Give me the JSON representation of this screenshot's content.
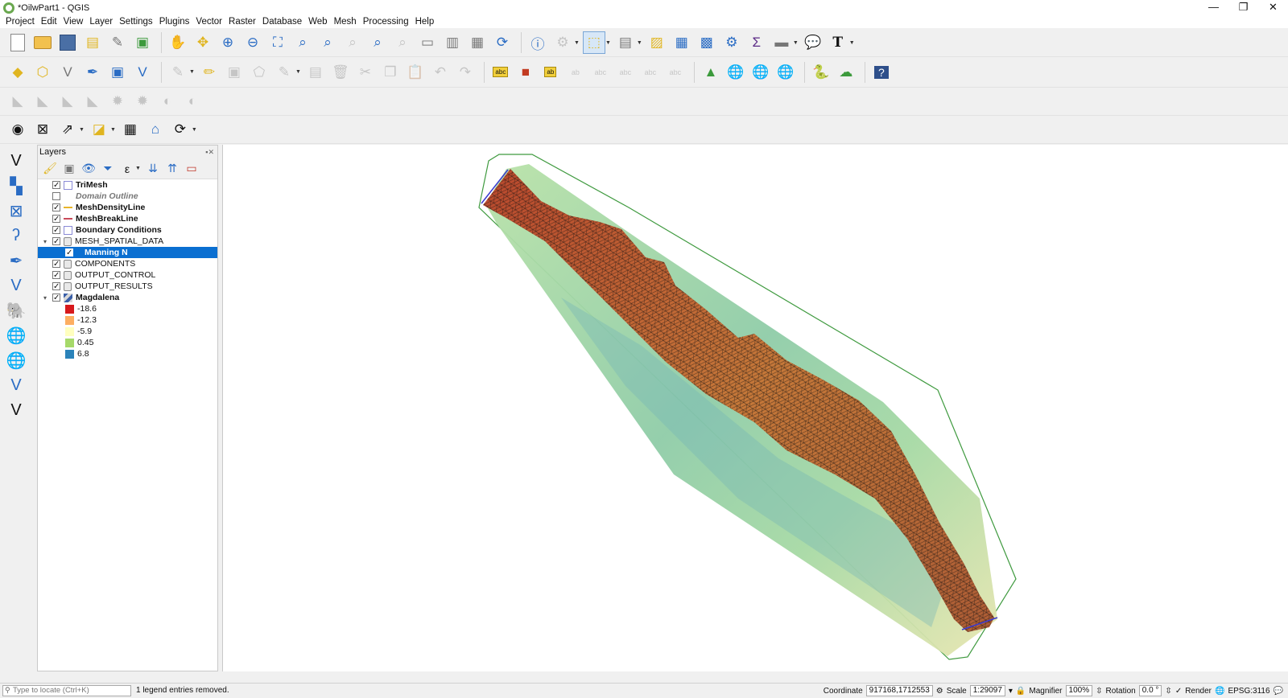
{
  "window": {
    "title": "*OilwPart1 - QGIS",
    "controls": [
      "—",
      "❐",
      "✕"
    ]
  },
  "menu": [
    "Project",
    "Edit",
    "View",
    "Layer",
    "Settings",
    "Plugins",
    "Vector",
    "Raster",
    "Database",
    "Web",
    "Mesh",
    "Processing",
    "Help"
  ],
  "layers_panel": {
    "title": "Layers",
    "close_glyph": "▪✕",
    "layers": [
      {
        "name": "TriMesh",
        "checked": true,
        "symbol": "poly"
      },
      {
        "name": "Domain Outline",
        "checked": false,
        "symbol": "none"
      },
      {
        "name": "MeshDensityLine",
        "checked": true,
        "symbol": "line-yellow"
      },
      {
        "name": "MeshBreakLine",
        "checked": true,
        "symbol": "line-red"
      },
      {
        "name": "Boundary Conditions",
        "checked": true,
        "symbol": "poly"
      },
      {
        "name": "MESH_SPATIAL_DATA",
        "checked": true,
        "symbol": "group",
        "expander": "▾"
      },
      {
        "name": "Manning N",
        "checked": true,
        "selected": true
      },
      {
        "name": "COMPONENTS",
        "checked": true,
        "symbol": "group"
      },
      {
        "name": "OUTPUT_CONTROL",
        "checked": true,
        "symbol": "group"
      },
      {
        "name": "OUTPUT_RESULTS",
        "checked": true,
        "symbol": "group"
      },
      {
        "name": "Magdalena",
        "checked": true,
        "symbol": "mesh",
        "expander": "▾"
      }
    ],
    "legend": [
      {
        "label": "-18.6",
        "color": "#d7191c"
      },
      {
        "label": "-12.3",
        "color": "#fdae61"
      },
      {
        "label": "-5.9",
        "color": "#ffffbf"
      },
      {
        "label": "0.45",
        "color": "#a6d96a"
      },
      {
        "label": "6.8",
        "color": "#2b83ba"
      }
    ]
  },
  "status": {
    "locator_placeholder": "Type to locate (Ctrl+K)",
    "message": "1 legend entries removed.",
    "coordinate_label": "Coordinate",
    "coordinate": "917168,1712553",
    "scale_label": "Scale",
    "scale": "1:29097",
    "magnifier_label": "Magnifier",
    "magnifier": "100%",
    "rotation_label": "Rotation",
    "rotation": "0.0 °",
    "render_label": "Render",
    "crs": "EPSG:3116"
  },
  "colors": {
    "selection": "#0a6fd1",
    "outline": "#3f9a3f",
    "mesh": "#111111",
    "boundary": "#3a3ad0"
  }
}
